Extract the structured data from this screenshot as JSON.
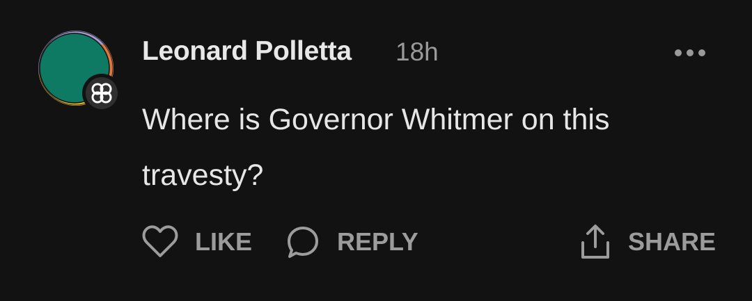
{
  "comment": {
    "author": "Leonard Polletta",
    "time": "18h",
    "text": "Where is Governor Whitmer on this travesty?",
    "avatar_badge_icon": "community-flower-icon",
    "more_icon": "more-dots-icon"
  },
  "actions": {
    "like_label": "LIKE",
    "reply_label": "REPLY",
    "share_label": "SHARE",
    "like_icon": "heart-icon",
    "reply_icon": "speech-bubble-icon",
    "share_icon": "share-upload-icon"
  },
  "colors": {
    "background": "#121212",
    "text_primary": "#e6e6e6",
    "text_secondary": "#9a9a9a",
    "avatar_green": "#0e7a63",
    "avatar_orange": "#e0763c",
    "avatar_yellow": "#e6b022",
    "avatar_lavender": "#a79bd3"
  }
}
